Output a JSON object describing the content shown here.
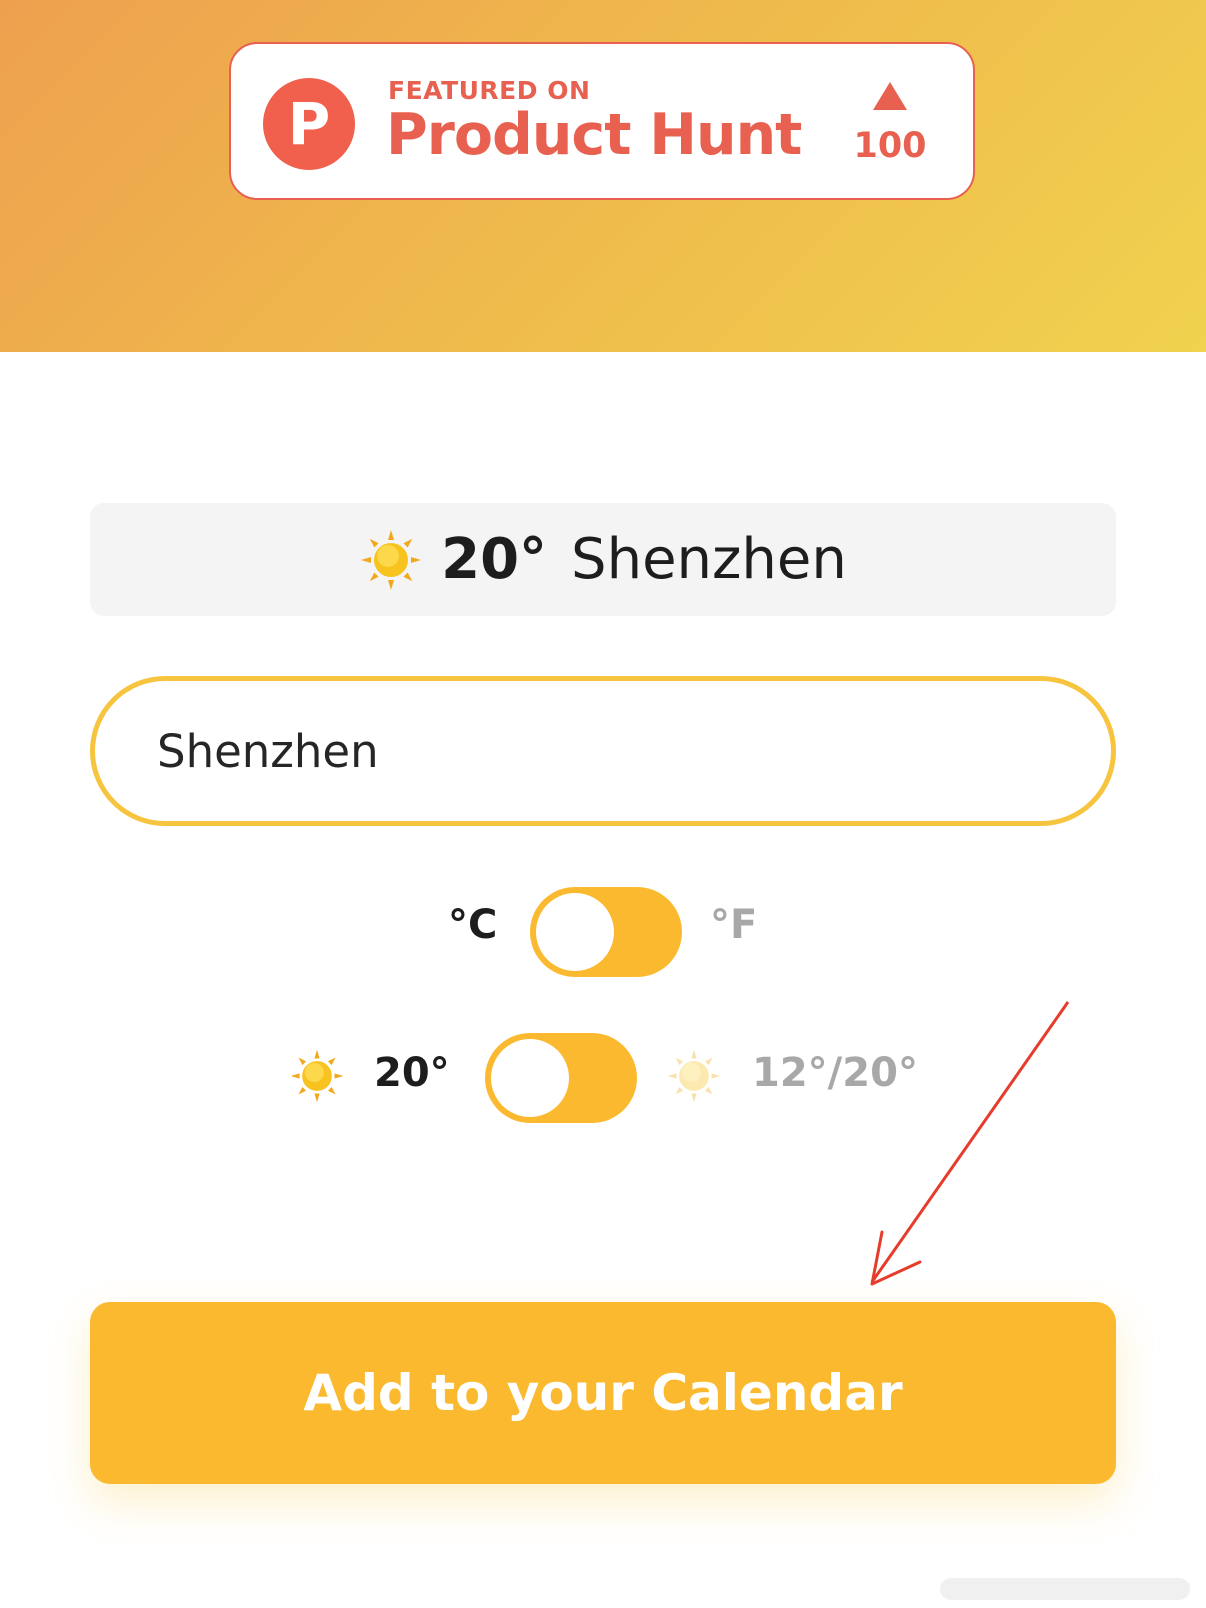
{
  "colors": {
    "accent": "#fbb92f",
    "input_border": "#f6c43e",
    "product_hunt": "#e8604f",
    "muted_text": "#a8a8a8",
    "annotation_arrow": "#e53c2c"
  },
  "badge": {
    "logo_letter": "P",
    "featured_label": "FEATURED ON",
    "name": "Product Hunt",
    "upvote_icon": "triangle-up-icon",
    "upvotes": "100"
  },
  "weather": {
    "icon": "sun-icon",
    "temperature": "20°",
    "city": "Shenzhen"
  },
  "search": {
    "value": "Shenzhen"
  },
  "unit_toggle": {
    "left_label": "°C",
    "right_label": "°F",
    "selected": "°C"
  },
  "display_toggle": {
    "left_icon": "sun-icon",
    "left_label": "20°",
    "right_icon": "sun-icon",
    "right_label": "12°/20°",
    "selected": "20°"
  },
  "cta": {
    "label": "Add to your Calendar"
  }
}
